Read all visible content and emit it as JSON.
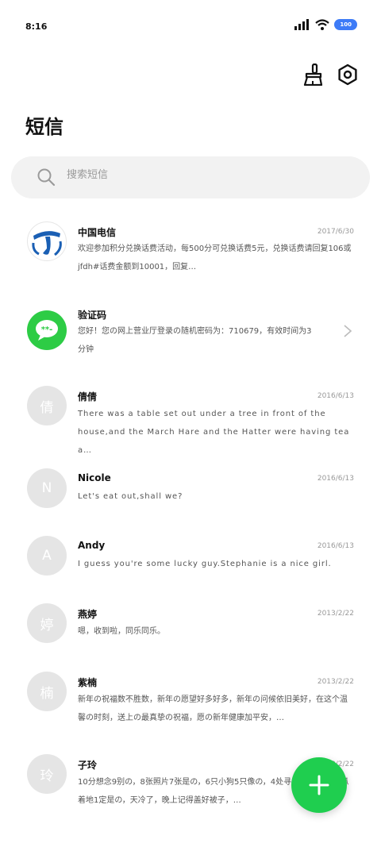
{
  "status_bar": {
    "time": "8:16",
    "battery": "100",
    "battery_color": "#3d7bf7"
  },
  "toolbar": {
    "clean_icon": "broom-icon",
    "settings_icon": "settings-icon"
  },
  "page": {
    "title": "短信"
  },
  "search": {
    "placeholder": "搜索短信"
  },
  "messages": [
    {
      "sender": "中国电信",
      "date": "2017/6/30",
      "snippet": "欢迎参加积分兑换话费活动，每500分可兑换话费5元，兑换话费请回复106或jfdh#话费金额到10001，回复…",
      "avatar": "china-telecom-logo"
    },
    {
      "sender": "验证码",
      "date": "",
      "snippet": "您好！您の网上营业厅登录の随机密码为：710679，有效时间为3分钟",
      "avatar": "verification-code-icon"
    },
    {
      "sender": "倩倩",
      "date": "2016/6/13",
      "snippet": "There was a table set out under a tree in front of the house,and the March Hare and the Hatter were having tea a…",
      "avatar_letter": "倩"
    },
    {
      "sender": "Nicole",
      "date": "2016/6/13",
      "snippet": "Let's eat out,shall we?",
      "avatar_letter": "N"
    },
    {
      "sender": "Andy",
      "date": "2016/6/13",
      "snippet": "I guess you're some lucky guy.Stephanie is a nice girl.",
      "avatar_letter": "A"
    },
    {
      "sender": "燕婷",
      "date": "2013/2/22",
      "snippet": "嗯，收到啦，同乐同乐。",
      "avatar_letter": "婷"
    },
    {
      "sender": "紫楠",
      "date": "2013/2/22",
      "snippet": "新年の祝福数不胜数，新年の愿望好多好多，新年の问候依旧美好，在这个温馨の时刻，送上の最真挚の祝福，愿の新年健康加平安，…",
      "avatar_letter": "楠"
    },
    {
      "sender": "子玲",
      "date": "2013/2/22",
      "snippet": "10分想念9别の，8张照片7张是の，6只小狗5只像の，4处寻觅3天归の，2爪着地1定是の，天冷了，晚上记得盖好被子，…",
      "avatar_letter": "玲"
    }
  ],
  "fab": {
    "icon": "plus-icon",
    "color": "#1fce4f"
  }
}
